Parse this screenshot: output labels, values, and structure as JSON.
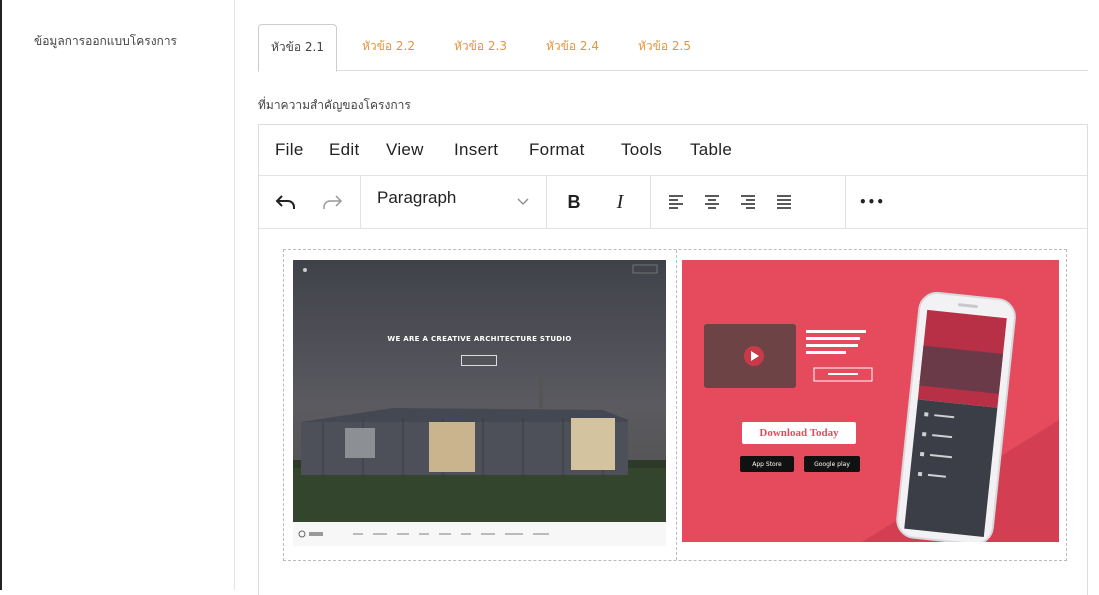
{
  "form": {
    "field_label": "ข้อมูลการออกแบบโครงการ",
    "section_title": "ที่มาความสำคัญของโครงการ"
  },
  "tabs": [
    {
      "label": "หัวข้อ 2.1",
      "active": true
    },
    {
      "label": "หัวข้อ 2.2",
      "active": false
    },
    {
      "label": "หัวข้อ 2.3",
      "active": false
    },
    {
      "label": "หัวข้อ 2.4",
      "active": false
    },
    {
      "label": "หัวข้อ 2.5",
      "active": false
    }
  ],
  "editor": {
    "menu": [
      "File",
      "Edit",
      "View",
      "Insert",
      "Format",
      "Tools",
      "Table"
    ],
    "toolbar": {
      "undo_icon": "undo-icon",
      "redo_icon": "redo-icon",
      "block_format": "Paragraph",
      "bold": "B",
      "italic": "I",
      "more": "•••"
    },
    "images": {
      "image1": {
        "headline": "WE ARE A CREATIVE ARCHITECTURE STUDIO"
      },
      "image2": {
        "download_button": "Download Today",
        "app_store": "App Store",
        "google_play": "Google play"
      }
    }
  },
  "colors": {
    "tab_inactive": "#e3953b",
    "app_banner": "#e64a5d"
  }
}
